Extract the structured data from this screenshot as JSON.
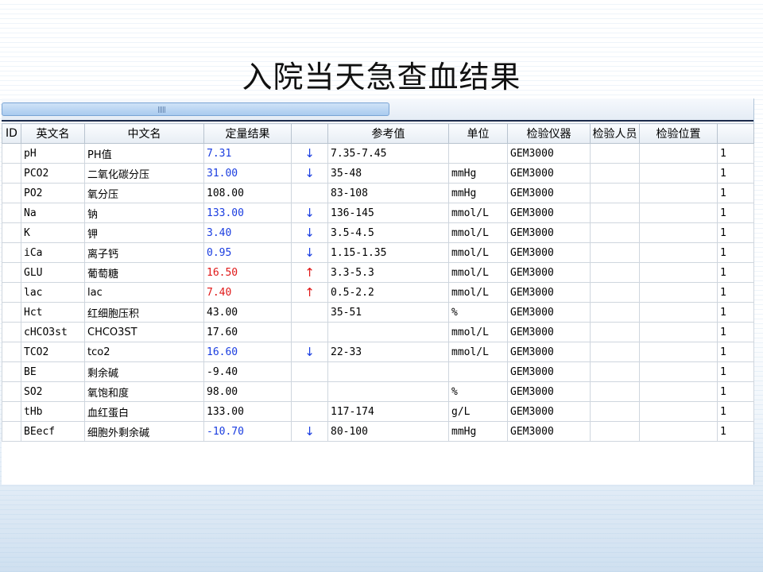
{
  "slide": {
    "title": "入院当天急查血结果"
  },
  "colors": {
    "low": "#1a3de0",
    "high": "#e01818",
    "normal": "#000000"
  },
  "icons": {
    "low_flag": "arrow-down-icon",
    "high_flag": "arrow-up-icon"
  },
  "table": {
    "columns": [
      "ID",
      "英文名",
      "中文名",
      "定量结果",
      "",
      "参考值",
      "单位",
      "检验仪器",
      "检验人员",
      "检验位置",
      ""
    ],
    "rows": [
      {
        "id": "",
        "en": "pH",
        "cn": "PH值",
        "result": "7.31",
        "flag": "↓",
        "status": "low",
        "ref": "7.35-7.45",
        "unit": "",
        "instrument": "GEM3000",
        "staff": "",
        "location": "",
        "extra": "1"
      },
      {
        "id": "",
        "en": "PCO2",
        "cn": "二氧化碳分压",
        "result": "31.00",
        "flag": "↓",
        "status": "low",
        "ref": "35-48",
        "unit": "mmHg",
        "instrument": "GEM3000",
        "staff": "",
        "location": "",
        "extra": "1"
      },
      {
        "id": "",
        "en": "PO2",
        "cn": "氧分压",
        "result": "108.00",
        "flag": "",
        "status": "normal",
        "ref": "83-108",
        "unit": "mmHg",
        "instrument": "GEM3000",
        "staff": "",
        "location": "",
        "extra": "1"
      },
      {
        "id": "",
        "en": "Na",
        "cn": "钠",
        "result": "133.00",
        "flag": "↓",
        "status": "low",
        "ref": "136-145",
        "unit": "mmol/L",
        "instrument": "GEM3000",
        "staff": "",
        "location": "",
        "extra": "1"
      },
      {
        "id": "",
        "en": "K",
        "cn": "钾",
        "result": "3.40",
        "flag": "↓",
        "status": "low",
        "ref": "3.5-4.5",
        "unit": "mmol/L",
        "instrument": "GEM3000",
        "staff": "",
        "location": "",
        "extra": "1"
      },
      {
        "id": "",
        "en": "iCa",
        "cn": "离子钙",
        "result": "0.95",
        "flag": "↓",
        "status": "low",
        "ref": "1.15-1.35",
        "unit": "mmol/L",
        "instrument": "GEM3000",
        "staff": "",
        "location": "",
        "extra": "1"
      },
      {
        "id": "",
        "en": "GLU",
        "cn": "葡萄糖",
        "result": "16.50",
        "flag": "↑",
        "status": "high",
        "ref": "3.3-5.3",
        "unit": "mmol/L",
        "instrument": "GEM3000",
        "staff": "",
        "location": "",
        "extra": "1"
      },
      {
        "id": "",
        "en": "lac",
        "cn": "lac",
        "result": "7.40",
        "flag": "↑",
        "status": "high",
        "ref": "0.5-2.2",
        "unit": "mmol/L",
        "instrument": "GEM3000",
        "staff": "",
        "location": "",
        "extra": "1"
      },
      {
        "id": "",
        "en": "Hct",
        "cn": "红细胞压积",
        "result": "43.00",
        "flag": "",
        "status": "normal",
        "ref": "35-51",
        "unit": "%",
        "instrument": "GEM3000",
        "staff": "",
        "location": "",
        "extra": "1"
      },
      {
        "id": "",
        "en": "cHCO3st",
        "cn": "CHCO3ST",
        "result": "17.60",
        "flag": "",
        "status": "normal",
        "ref": "",
        "unit": "mmol/L",
        "instrument": "GEM3000",
        "staff": "",
        "location": "",
        "extra": "1"
      },
      {
        "id": "",
        "en": "TCO2",
        "cn": "tco2",
        "result": "16.60",
        "flag": "↓",
        "status": "low",
        "ref": "22-33",
        "unit": "mmol/L",
        "instrument": "GEM3000",
        "staff": "",
        "location": "",
        "extra": "1"
      },
      {
        "id": "",
        "en": "BE",
        "cn": "剩余碱",
        "result": "-9.40",
        "flag": "",
        "status": "normal",
        "ref": "",
        "unit": "",
        "instrument": "GEM3000",
        "staff": "",
        "location": "",
        "extra": "1"
      },
      {
        "id": "",
        "en": "SO2",
        "cn": "氧饱和度",
        "result": "98.00",
        "flag": "",
        "status": "normal",
        "ref": "",
        "unit": "%",
        "instrument": "GEM3000",
        "staff": "",
        "location": "",
        "extra": "1"
      },
      {
        "id": "",
        "en": "tHb",
        "cn": "血红蛋白",
        "result": "133.00",
        "flag": "",
        "status": "normal",
        "ref": "117-174",
        "unit": "g/L",
        "instrument": "GEM3000",
        "staff": "",
        "location": "",
        "extra": "1"
      },
      {
        "id": "",
        "en": "BEecf",
        "cn": "细胞外剩余碱",
        "result": "-10.70",
        "flag": "↓",
        "status": "low",
        "ref": "80-100",
        "unit": "mmHg",
        "instrument": "GEM3000",
        "staff": "",
        "location": "",
        "extra": "1"
      }
    ]
  }
}
